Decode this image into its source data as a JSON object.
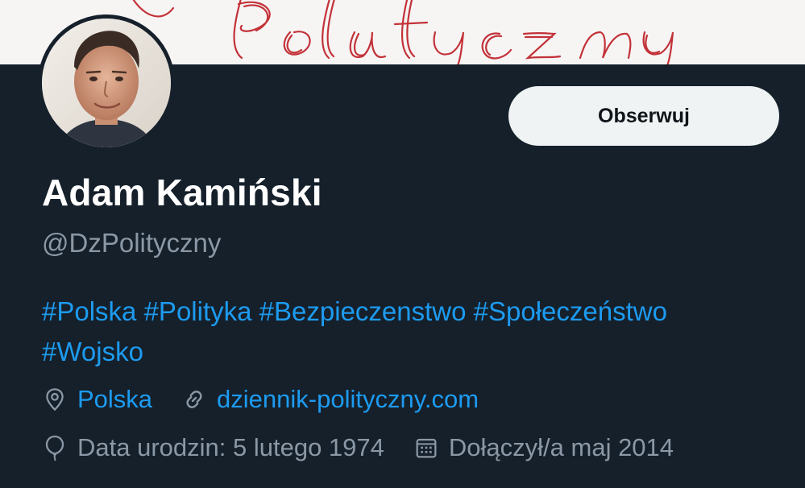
{
  "banner": {
    "text": "Polityczny",
    "color": "#c0282e"
  },
  "profile": {
    "name": "Adam Kamiński",
    "handle": "@DzPolityczny",
    "follow_label": "Obserwuj"
  },
  "bio": {
    "hashtags": [
      "#Polska",
      "#Polityka",
      "#Bezpieczenstwo",
      "#Społeczeństwo",
      "#Wojsko"
    ]
  },
  "meta": {
    "location": "Polska",
    "website": "dziennik-polityczny.com",
    "birth_date": "Data urodzin: 5 lutego 1974",
    "joined": "Dołączył/a maj 2014"
  },
  "icons": {
    "location": "location-pin-icon",
    "website": "link-icon",
    "birth": "balloon-icon",
    "joined": "calendar-icon"
  },
  "colors": {
    "background": "#15202b",
    "accent": "#1d9bf0",
    "secondary_text": "#8b98a5",
    "button_bg": "#eff3f4"
  }
}
